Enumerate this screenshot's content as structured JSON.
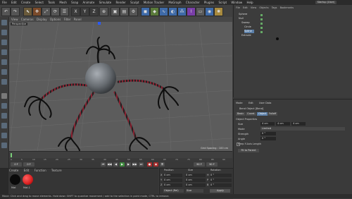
{
  "menubar": {
    "items": [
      "File",
      "Edit",
      "Create",
      "Select",
      "Tools",
      "Mesh",
      "Snap",
      "Animate",
      "Simulate",
      "Render",
      "Sculpt",
      "Motion Tracker",
      "MoGraph",
      "Character",
      "Plugins",
      "Script",
      "Window",
      "Help"
    ],
    "layout_label": "Startup (User)"
  },
  "toolbar": {
    "axis_labels": [
      "X",
      "Y",
      "Z"
    ]
  },
  "viewport": {
    "menu": [
      "View",
      "Cameras",
      "Display",
      "Options",
      "Filter",
      "Panel"
    ],
    "label": "Perspective",
    "grid_spacing": "Grid Spacing : 100 cm"
  },
  "timeline": {
    "ticks": [
      "0",
      "5",
      "10",
      "15",
      "20",
      "25",
      "30",
      "35",
      "40",
      "45",
      "50",
      "55",
      "60",
      "65",
      "70",
      "75",
      "80",
      "85",
      "90"
    ],
    "frame_start": "0 F",
    "frame_end": "90 F"
  },
  "materials": {
    "menu": [
      "Create",
      "Edit",
      "Function",
      "Texture"
    ],
    "swatch_labels": [
      "Mat",
      "Mat.1"
    ]
  },
  "coordinates": {
    "headers": [
      "Position",
      "Size",
      "Rotation"
    ],
    "rows": [
      {
        "axis": "X",
        "pos": "0 cm",
        "size": "0 cm",
        "rot_label": "H",
        "rot": "0 °"
      },
      {
        "axis": "Y",
        "pos": "0 cm",
        "size": "0 cm",
        "rot_label": "P",
        "rot": "0 °"
      },
      {
        "axis": "Z",
        "pos": "0 cm",
        "size": "0 cm",
        "rot_label": "B",
        "rot": "0 °"
      }
    ],
    "mode_select": "Object (Rel)",
    "size_select": "Size",
    "apply_label": "Apply"
  },
  "objects": {
    "menu": [
      "File",
      "Edit",
      "View",
      "Objects",
      "Tags",
      "Bookmarks"
    ],
    "items": [
      "Sphere",
      "Null",
      "Sweep",
      "Circle",
      "Spline",
      "Extrude"
    ]
  },
  "attributes": {
    "menu": [
      "Mode",
      "Edit",
      "User Data"
    ],
    "title": "Bend Object [Bend]",
    "tabs": [
      "Basic",
      "Coord.",
      "Object",
      "Falloff"
    ],
    "section": "Object Properties",
    "fields": [
      {
        "label": "Size",
        "value": "4 cm"
      },
      {
        "label": "Mode",
        "value": "Limited"
      },
      {
        "label": "Strength",
        "value": "0 °"
      },
      {
        "label": "Angle",
        "value": "0 °"
      },
      {
        "label": "Keep Y-Axis Length",
        "value": ""
      }
    ],
    "fit_button": "Fit to Parent"
  },
  "statusbar": {
    "text": "Move: Click and drag to move elements. Hold down SHIFT to quantize movement / add to the selection in point mode, CTRL to remove."
  },
  "colors": {
    "accent": "#5b7fa8",
    "swatch_red": "#d92020",
    "swatch_black": "#0a0a0a"
  }
}
